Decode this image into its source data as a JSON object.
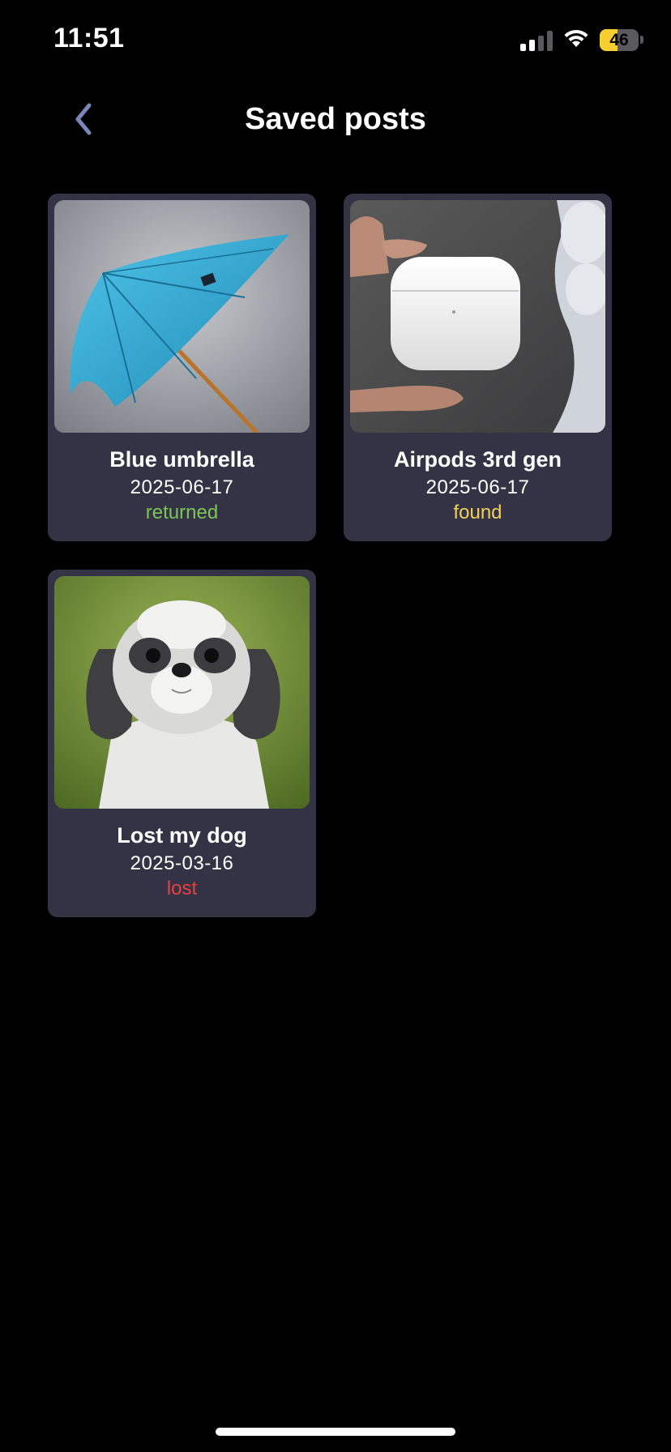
{
  "status_bar": {
    "time": "11:51",
    "battery_level": "46",
    "battery_fraction": 0.46,
    "battery_color": "#f7ce2f",
    "signal_bars_active": 2,
    "signal_bars_total": 4,
    "icons": [
      "signal-icon",
      "wifi-icon",
      "battery-icon"
    ]
  },
  "header": {
    "title": "Saved posts",
    "back_icon": "chevron-left-icon",
    "back_icon_color": "#7b86b8"
  },
  "posts": [
    {
      "title": "Blue umbrella",
      "date": "2025-06-17",
      "status": "returned",
      "status_color": "#7cc555",
      "image": "umbrella-photo"
    },
    {
      "title": "Airpods 3rd gen",
      "date": "2025-06-17",
      "status": "found",
      "status_color": "#f2cf5a",
      "image": "airpods-case-photo"
    },
    {
      "title": "Lost my dog",
      "date": "2025-03-16",
      "status": "lost",
      "status_color": "#e84040",
      "image": "dog-photo"
    }
  ],
  "colors": {
    "background": "#000000",
    "card": "#343346",
    "text": "#ffffff"
  }
}
